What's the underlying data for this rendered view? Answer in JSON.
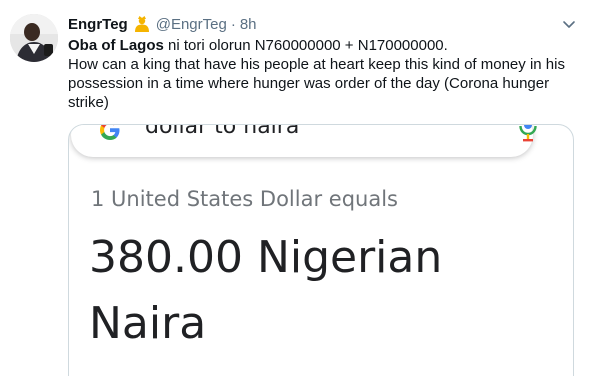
{
  "tweet": {
    "display_name": "EngrTeg",
    "handle": "@EngrTeg",
    "separator": "·",
    "timestamp": "8h",
    "text_bold": "Oba of Lagos",
    "text_line1_rest": " ni tori olorun N760000000 + N170000000.",
    "text_body": "How can a king that have his people at heart keep this kind of money in his possession in a time where hunger was order of the day (Corona hunger strike)"
  },
  "icons": {
    "avatar": "avatar-photo",
    "badge": "crown-icon",
    "menu": "chevron-down-icon",
    "search_logo": "google-g-icon",
    "voice": "microphone-icon"
  },
  "media": {
    "search_query": "dollar to naira",
    "result_subtitle": "1 United States Dollar equals",
    "result_value": "380.00 Nigerian Naira"
  },
  "colors": {
    "secondary_text": "#5b7083",
    "card_border": "#cfd9de",
    "google_blue": "#4285f4",
    "google_red": "#ea4335",
    "google_yellow": "#fbbc05",
    "google_green": "#34a853"
  }
}
